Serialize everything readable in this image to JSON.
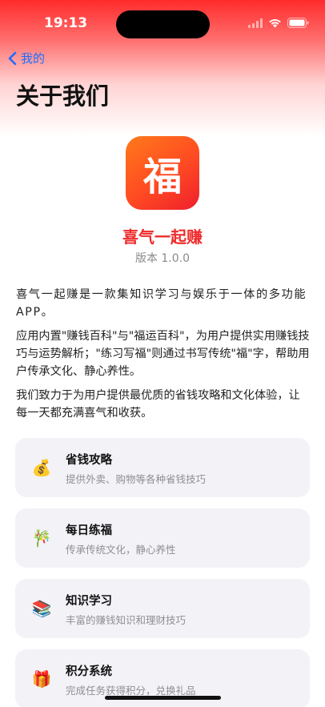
{
  "status": {
    "time": "19:13"
  },
  "nav": {
    "back_label": "我的",
    "title": "关于我们"
  },
  "app": {
    "icon_char": "福",
    "name": "喜气一起赚",
    "version": "版本 1.0.0"
  },
  "description": [
    "喜气一起赚是一款集知识学习与娱乐于一体的多功能APP。",
    "应用内置\"赚钱百科\"与\"福运百科\"，为用户提供实用赚钱技巧与运势解析；\"练习写福\"则通过书写传统\"福\"字，帮助用户传承文化、静心养性。",
    "我们致力于为用户提供最优质的省钱攻略和文化体验，让每一天都充满喜气和收获。"
  ],
  "features": [
    {
      "icon": "money-bag-icon",
      "emoji": "💰",
      "title": "省钱攻略",
      "subtitle": "提供外卖、购物等各种省钱技巧"
    },
    {
      "icon": "brush-icon",
      "emoji": "🎋",
      "title": "每日练福",
      "subtitle": "传承传统文化，静心养性"
    },
    {
      "icon": "books-icon",
      "emoji": "📚",
      "title": "知识学习",
      "subtitle": "丰富的赚钱知识和理财技巧"
    },
    {
      "icon": "gift-icon",
      "emoji": "🎁",
      "title": "积分系统",
      "subtitle": "完成任务获得积分，兑换礼品"
    }
  ],
  "colors": {
    "accent_red": "#ee2a2a",
    "link_blue": "#1d6dff",
    "card_bg": "#f2f2f7"
  }
}
